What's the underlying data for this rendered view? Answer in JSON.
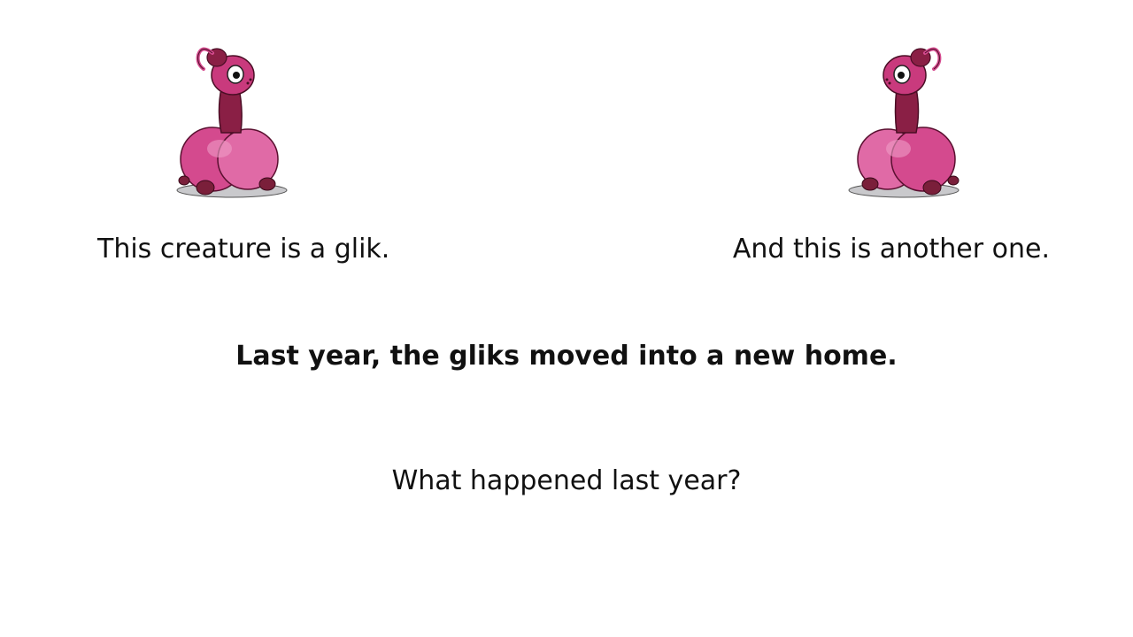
{
  "slide": {
    "caption_left": "This creature is a glik.",
    "caption_right": "And this is another one.",
    "statement": "Last year, the gliks moved into a new home.",
    "question": "What happened last year?"
  },
  "illustration": {
    "icon": "glik-creature-icon",
    "body_color": "#d44a8e",
    "body_light": "#e87db5",
    "neck_color": "#8a1f45",
    "foot_color": "#7a1f3a",
    "shadow_color": "#c9c9cc"
  }
}
